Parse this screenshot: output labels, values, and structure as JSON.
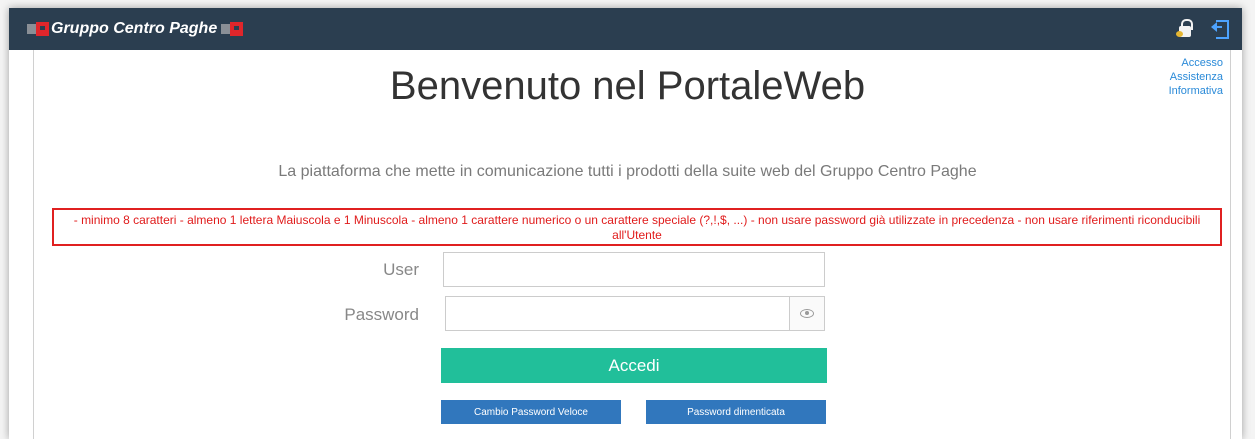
{
  "header": {
    "brand": "Gruppo Centro Paghe",
    "icons": [
      "lock-key-icon",
      "exit-icon"
    ],
    "bar_color": "#2b3e50"
  },
  "side_links": [
    "Accesso",
    "Assistenza",
    "Informativa"
  ],
  "main": {
    "title": "Benvenuto nel PortaleWeb",
    "tagline": "La piattaforma che mette in comunicazione tutti i prodotti della suite web del Gruppo Centro Paghe",
    "password_rules": "- minimo 8 caratteri - almeno 1 lettera Maiuscola e 1 Minuscola - almeno 1 carattere numerico o un carattere speciale (?,!,$, ...) - non usare password già utilizzate in precedenza - non usare riferimenti riconducibili all'Utente"
  },
  "form": {
    "user_label": "User",
    "user_value": "",
    "password_label": "Password",
    "password_value": "",
    "login_label": "Accedi",
    "quick_change_label": "Cambio Password Veloce",
    "forgot_label": "Password dimenticata"
  },
  "colors": {
    "accent_green": "#21bf9a",
    "button_blue": "#3177bd",
    "rules_red": "#e01b1b",
    "link_blue": "#2a8ad8"
  }
}
